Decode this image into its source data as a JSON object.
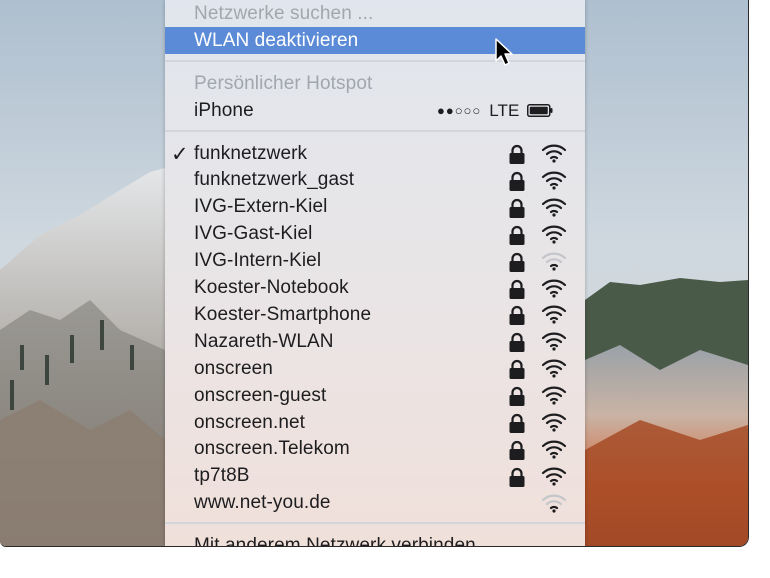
{
  "menu": {
    "scan_label": "Netzwerke suchen ...",
    "disable_wifi_label": "WLAN deaktivieren",
    "hotspot_header": "Persönlicher Hotspot",
    "hotspot_device": "iPhone",
    "hotspot_signal": "●●○○○",
    "hotspot_network_type": "LTE",
    "networks": [
      {
        "name": "funknetzwerk",
        "connected": true,
        "locked": true,
        "signal": "full"
      },
      {
        "name": "funknetzwerk_gast",
        "connected": false,
        "locked": true,
        "signal": "full"
      },
      {
        "name": "IVG-Extern-Kiel",
        "connected": false,
        "locked": true,
        "signal": "full"
      },
      {
        "name": "IVG-Gast-Kiel",
        "connected": false,
        "locked": true,
        "signal": "full"
      },
      {
        "name": "IVG-Intern-Kiel",
        "connected": false,
        "locked": true,
        "signal": "weak"
      },
      {
        "name": "Koester-Notebook",
        "connected": false,
        "locked": true,
        "signal": "full"
      },
      {
        "name": "Koester-Smartphone",
        "connected": false,
        "locked": true,
        "signal": "full"
      },
      {
        "name": "Nazareth-WLAN",
        "connected": false,
        "locked": true,
        "signal": "full"
      },
      {
        "name": "onscreen",
        "connected": false,
        "locked": true,
        "signal": "full"
      },
      {
        "name": "onscreen-guest",
        "connected": false,
        "locked": true,
        "signal": "full"
      },
      {
        "name": "onscreen.net",
        "connected": false,
        "locked": true,
        "signal": "full"
      },
      {
        "name": "onscreen.Telekom",
        "connected": false,
        "locked": true,
        "signal": "full"
      },
      {
        "name": "tp7t8B",
        "connected": false,
        "locked": true,
        "signal": "full"
      },
      {
        "name": "www.net-you.de",
        "connected": false,
        "locked": false,
        "signal": "weak"
      }
    ],
    "other_network_label": "Mit anderem Netzwerk verbinden ..."
  },
  "icons": {
    "check": "checkmark-icon",
    "lock": "lock-icon",
    "wifi": "wifi-signal-icon",
    "battery": "battery-icon",
    "cursor": "mouse-pointer-icon"
  },
  "colors": {
    "highlight": "#5b8ad6",
    "text": "#1d1d1f",
    "disabled_text": "#a2a6ad"
  }
}
